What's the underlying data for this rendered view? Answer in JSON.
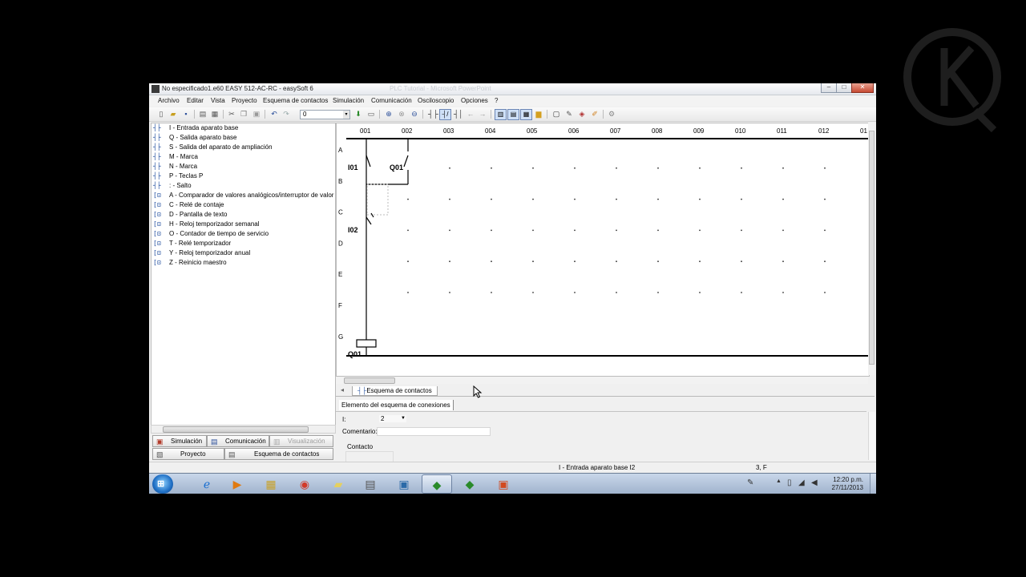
{
  "window": {
    "title": "No especificado1.e60 EASY 512-AC-RC - easySoft 6",
    "background_title": "PLC Tutorial - Microsoft PowerPoint",
    "controls": {
      "minimize": "–",
      "maximize": "□",
      "close": "✕"
    }
  },
  "menu": [
    "Archivo",
    "Editar",
    "Vista",
    "Proyecto",
    "Esquema de contactos",
    "Simulación",
    "Comunicación",
    "Osciloscopio",
    "Opciones",
    "?"
  ],
  "toolbar": {
    "combo_value": "0",
    "combo_arrow": "▾"
  },
  "tree": [
    {
      "icon": "┤├",
      "label": "I - Entrada aparato base"
    },
    {
      "icon": "┤├",
      "label": "Q - Salida aparato base"
    },
    {
      "icon": "┤├",
      "label": "S - Salida del aparato de ampliación"
    },
    {
      "icon": "┤├",
      "label": "M - Marca"
    },
    {
      "icon": "┤├",
      "label": "N - Marca"
    },
    {
      "icon": "┤├",
      "label": "P - Teclas P"
    },
    {
      "icon": "┤├",
      "label": ": - Salto"
    },
    {
      "icon": "[⊡",
      "label": "A - Comparador de valores analógicos/interruptor de valor"
    },
    {
      "icon": "[⊡",
      "label": "C - Relé de contaje"
    },
    {
      "icon": "[⊡",
      "label": "D - Pantalla de texto"
    },
    {
      "icon": "[⊡",
      "label": "H - Reloj temporizador semanal"
    },
    {
      "icon": "[⊡",
      "label": "O - Contador de tiempo de servicio"
    },
    {
      "icon": "[⊡",
      "label": "T - Relé temporizador"
    },
    {
      "icon": "[⊡",
      "label": "Y - Reloj temporizador anual"
    },
    {
      "icon": "[⊡",
      "label": "Z - Reinicio maestro"
    }
  ],
  "left_tabs": {
    "simulacion": "Simulación",
    "comunicacion": "Comunicación",
    "visualizacion": "Visualización",
    "proyecto": "Proyecto",
    "esquema": "Esquema de contactos"
  },
  "diagram": {
    "columns": [
      "001",
      "002",
      "003",
      "004",
      "005",
      "006",
      "007",
      "008",
      "009",
      "010",
      "011",
      "012",
      "01"
    ],
    "rows": [
      "A",
      "B",
      "C",
      "D",
      "E",
      "F",
      "G"
    ],
    "labels": {
      "i01": "I01",
      "q01": "Q01",
      "i02": "I02",
      "q01_coil": "Q01"
    }
  },
  "sheet_tab": {
    "icon": "┤├",
    "label": "Esquema de contactos"
  },
  "props": {
    "tab": "Elemento del esquema de conexiones",
    "i_label": "I:",
    "i_value": "2",
    "comment_label": "Comentario:",
    "contact_label": "Contacto"
  },
  "status": {
    "element": "I - Entrada aparato base I2",
    "position": "3, F"
  },
  "taskbar": {
    "apps": [
      "internet-explorer",
      "media-player",
      "file-explorer",
      "chrome",
      "notes",
      "calculator",
      "monitor",
      "easysoft",
      "easysoft-2",
      "presentation"
    ],
    "time": "12:20 p.m.",
    "date": "27/11/2013"
  },
  "colors": {
    "titlebar": "#e6e9ee",
    "taskbar": "#9fb2cc",
    "coil": "#000000"
  }
}
